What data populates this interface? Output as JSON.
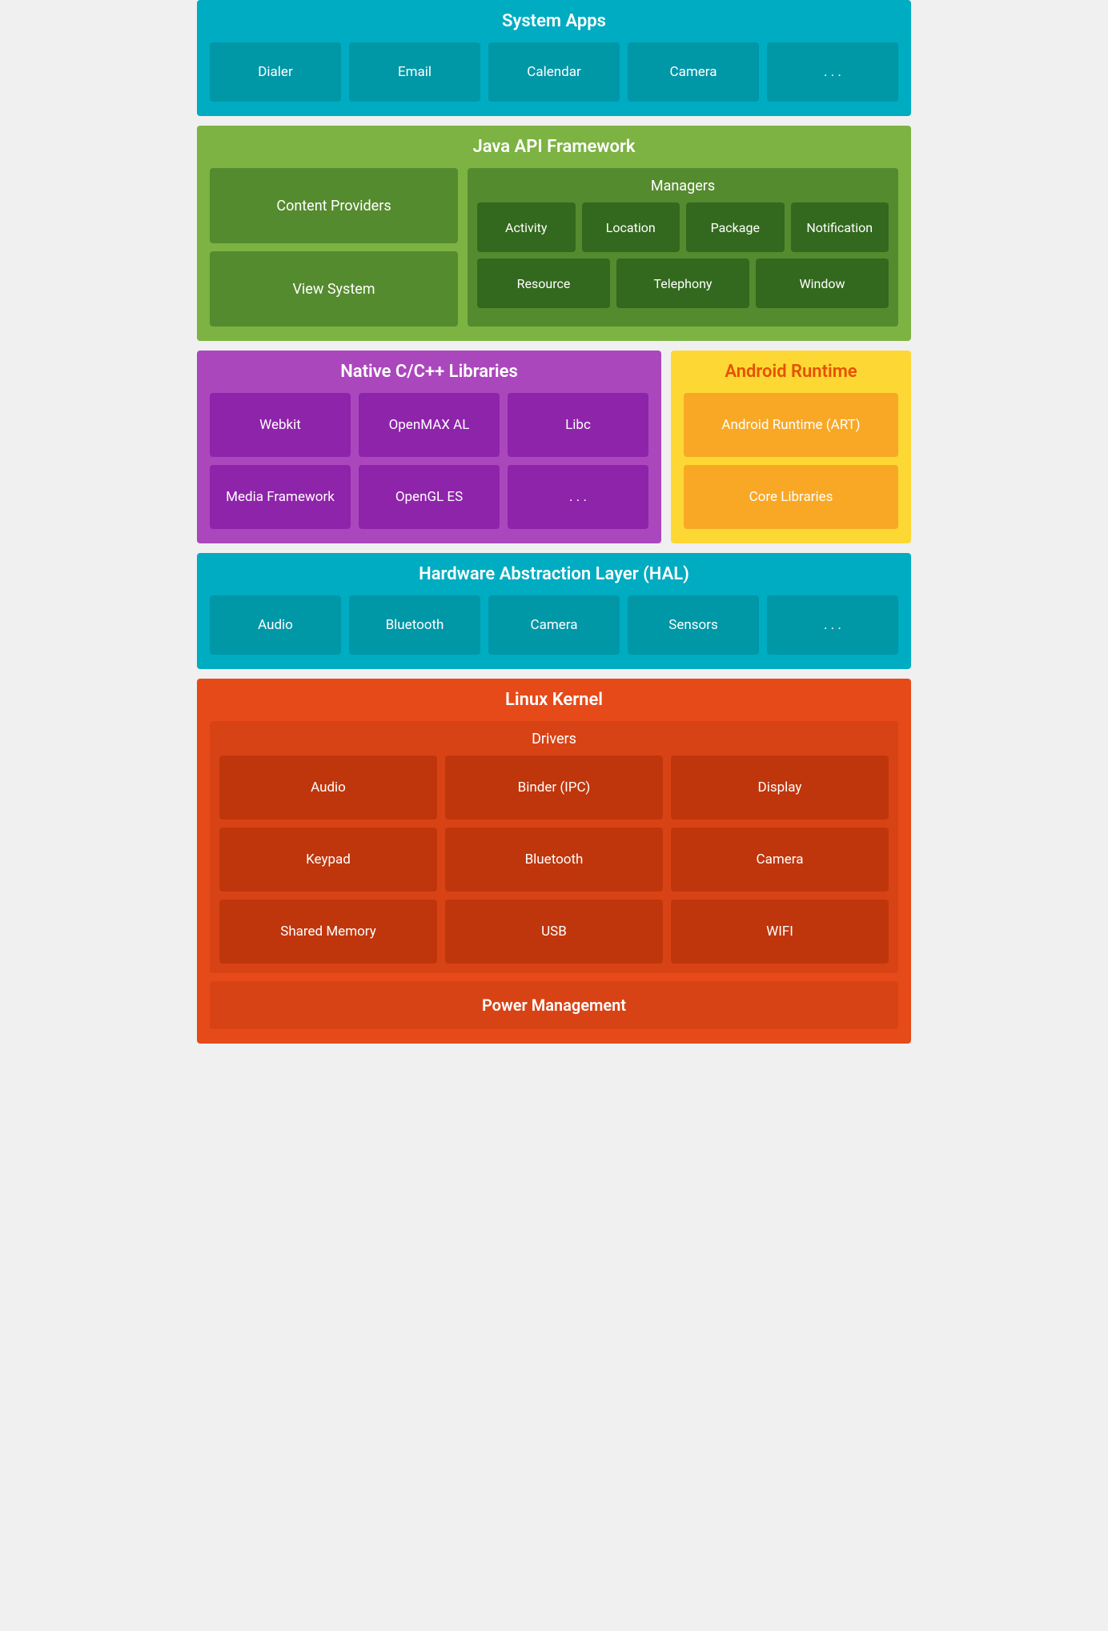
{
  "systemApps": {
    "title": "System Apps",
    "tiles": [
      "Dialer",
      "Email",
      "Calendar",
      "Camera",
      ". . ."
    ]
  },
  "javaApi": {
    "title": "Java API Framework",
    "left": [
      "Content Providers",
      "View System"
    ],
    "managers": {
      "title": "Managers",
      "row1": [
        "Activity",
        "Location",
        "Package",
        "Notification"
      ],
      "row2": [
        "Resource",
        "Telephony",
        "Window"
      ]
    }
  },
  "nativeCpp": {
    "title": "Native C/C++ Libraries",
    "tiles": [
      "Webkit",
      "OpenMAX AL",
      "Libc",
      "Media Framework",
      "OpenGL ES",
      ". . ."
    ]
  },
  "androidRuntime": {
    "title": "Android Runtime",
    "tiles": [
      "Android Runtime (ART)",
      "Core Libraries"
    ]
  },
  "hal": {
    "title": "Hardware Abstraction Layer (HAL)",
    "tiles": [
      "Audio",
      "Bluetooth",
      "Camera",
      "Sensors",
      ". . ."
    ]
  },
  "linuxKernel": {
    "title": "Linux Kernel",
    "drivers": {
      "title": "Drivers",
      "tiles": [
        "Audio",
        "Binder (IPC)",
        "Display",
        "Keypad",
        "Bluetooth",
        "Camera",
        "Shared Memory",
        "USB",
        "WIFI"
      ]
    },
    "powerManagement": "Power Management"
  }
}
